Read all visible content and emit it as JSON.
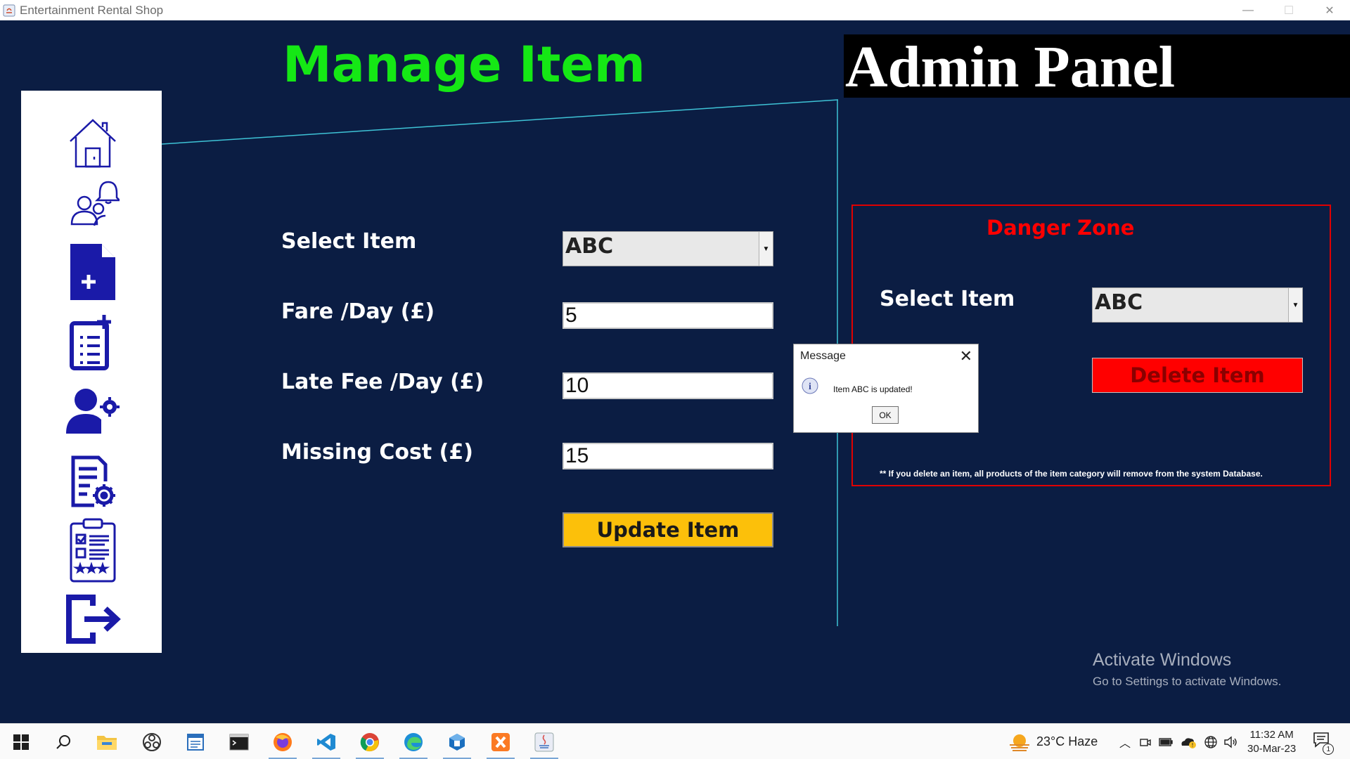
{
  "window": {
    "title": "Entertainment Rental Shop",
    "controls": {
      "minimize": "—",
      "maximize": "☐",
      "close": "✕"
    }
  },
  "header": {
    "page_title": "Manage Item",
    "panel_title": "Admin Panel"
  },
  "sidebar": {
    "items": [
      {
        "icon": "home-icon"
      },
      {
        "icon": "users-bell-icon"
      },
      {
        "icon": "add-document-icon"
      },
      {
        "icon": "add-list-icon"
      },
      {
        "icon": "user-settings-icon"
      },
      {
        "icon": "document-settings-icon"
      },
      {
        "icon": "clipboard-rating-icon"
      },
      {
        "icon": "logout-icon"
      }
    ]
  },
  "form": {
    "select_item_label": "Select Item",
    "select_item_value": "ABC",
    "fare_label": "Fare /Day (£)",
    "fare_value": "5",
    "late_fee_label": "Late Fee /Day (£)",
    "late_fee_value": "10",
    "missing_cost_label": "Missing Cost (£)",
    "missing_cost_value": "15",
    "update_button": "Update Item"
  },
  "danger_zone": {
    "title": "Danger Zone",
    "select_item_label": "Select Item",
    "select_item_value": "ABC",
    "delete_button": "Delete Item",
    "note": "** If you delete an item, all products of the item category will remove from the system Database."
  },
  "dialog": {
    "title": "Message",
    "message": "Item ABC is updated!",
    "ok_button": "OK",
    "close": "✕"
  },
  "watermark": {
    "line1": "Activate Windows",
    "line2": "Go to Settings to activate Windows."
  },
  "taskbar": {
    "apps": [
      "start-icon",
      "search-icon",
      "file-explorer-icon",
      "obs-icon",
      "notepad-icon",
      "terminal-icon",
      "firefox-icon",
      "vscode-icon",
      "chrome-icon",
      "edge-icon",
      "virtualbox-icon",
      "xampp-icon",
      "java-icon"
    ],
    "weather": "23°C  Haze",
    "time": "11:32 AM",
    "date": "30-Mar-23",
    "notifications": "1"
  },
  "colors": {
    "background": "#0b1d43",
    "title_green": "#15e815",
    "update_yellow": "#fcc00a",
    "danger_red": "#ff0000",
    "line_cyan": "#3ec3d6",
    "icon_blue": "#1a1aa8"
  }
}
